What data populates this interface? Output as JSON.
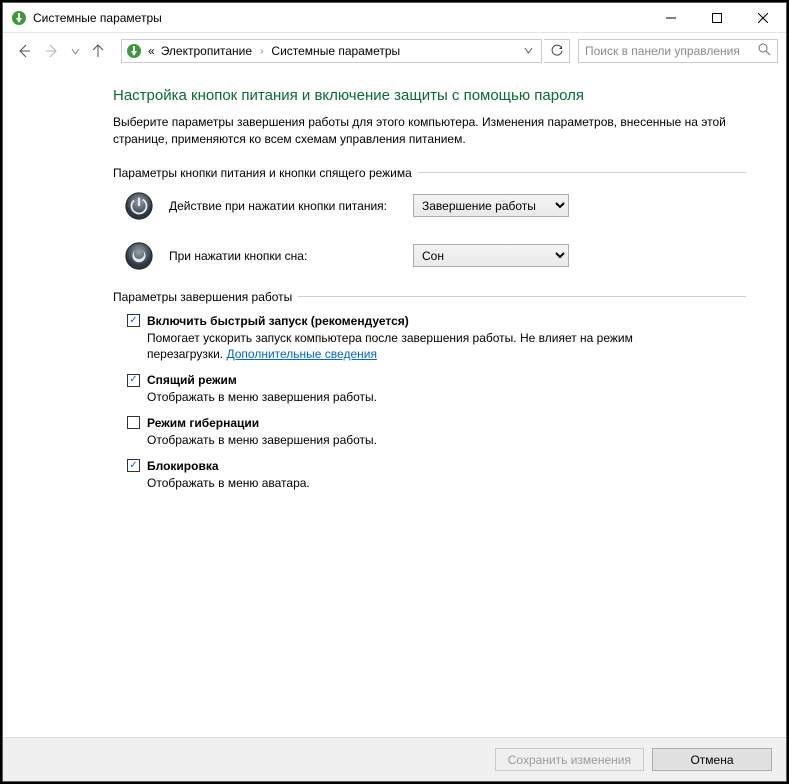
{
  "window": {
    "title": "Системные параметры"
  },
  "breadcrumb": {
    "root_prefix": "«",
    "item1": "Электропитание",
    "item2": "Системные параметры"
  },
  "search": {
    "placeholder": "Поиск в панели управления"
  },
  "heading": "Настройка кнопок питания и включение защиты с помощью пароля",
  "intro": "Выберите параметры завершения работы для этого компьютера. Изменения параметров, внесенные на этой странице, применяются ко всем схемам управления питанием.",
  "group_buttons": {
    "title": "Параметры кнопки питания и кнопки спящего режима",
    "power_label": "Действие при нажатии кнопки питания:",
    "power_value": "Завершение работы",
    "sleep_label": "При нажатии кнопки сна:",
    "sleep_value": "Сон"
  },
  "group_shutdown": {
    "title": "Параметры завершения работы",
    "items": [
      {
        "checked": true,
        "label": "Включить быстрый запуск (рекомендуется)",
        "desc_pre": "Помогает ускорить запуск компьютера после завершения работы. Не влияет на режим перезагрузки. ",
        "link": "Дополнительные сведения"
      },
      {
        "checked": true,
        "label": "Спящий режим",
        "desc_pre": "Отображать в меню завершения работы.",
        "link": ""
      },
      {
        "checked": false,
        "label": "Режим гибернации",
        "desc_pre": "Отображать в меню завершения работы.",
        "link": ""
      },
      {
        "checked": true,
        "label": "Блокировка",
        "desc_pre": "Отображать в меню аватара.",
        "link": ""
      }
    ]
  },
  "footer": {
    "save": "Сохранить изменения",
    "cancel": "Отмена"
  }
}
